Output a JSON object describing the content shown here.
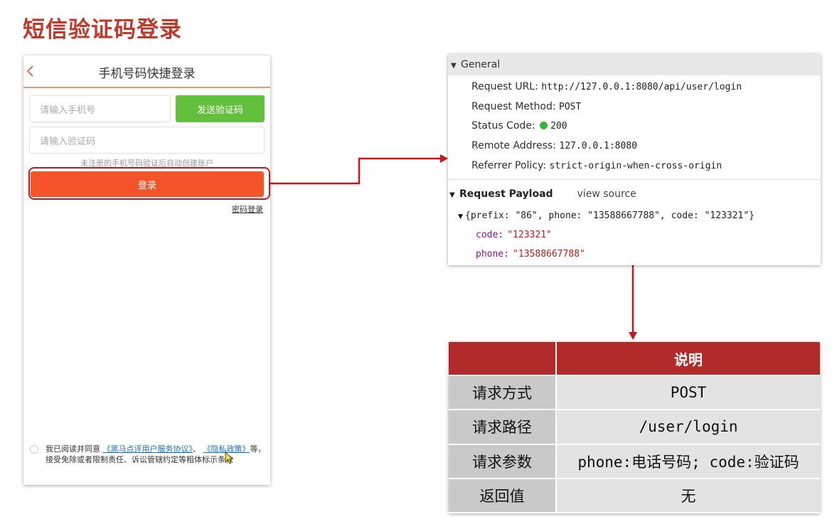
{
  "slide": {
    "title": "短信验证码登录"
  },
  "phone": {
    "title": "手机号码快捷登录",
    "phone_placeholder": "请输入手机号",
    "code_placeholder": "请输入验证码",
    "send_code_label": "发送验证码",
    "hint": "未注册的手机号码验证后自动创建账户",
    "login_label": "登录",
    "password_login_link": "密码登录",
    "agreement": {
      "prefix": "我已阅读并同意",
      "link1": "《黑马点评用户服务协议》",
      "sep": "、",
      "link2": "《隐私政策》",
      "suffix": "等，接受免除或者限制责任、诉讼管辖约定等粗体标示条款"
    },
    "accent_color": "#f5542a",
    "send_color": "#62c03c"
  },
  "devtools": {
    "general_label": "General",
    "rows": [
      {
        "key": "Request URL:",
        "value": "http://127.0.0.1:8080/api/user/login"
      },
      {
        "key": "Request Method:",
        "value": "POST"
      },
      {
        "key": "Status Code:",
        "value": "200"
      },
      {
        "key": "Remote Address:",
        "value": "127.0.0.1:8080"
      },
      {
        "key": "Referrer Policy:",
        "value": "strict-origin-when-cross-origin"
      }
    ],
    "payload_label": "Request Payload",
    "view_source": "view source",
    "payload_summary": "{prefix: \"86\", phone: \"13588667788\", code: \"123321\"}",
    "payload_fields": [
      {
        "key": "code:",
        "value": "\"123321\""
      },
      {
        "key": "phone:",
        "value": "\"13588667788\""
      }
    ],
    "status_color": "#3cb13c"
  },
  "info_table": {
    "header": {
      "left": "",
      "right": "说明"
    },
    "rows": [
      {
        "label": "请求方式",
        "value": "POST"
      },
      {
        "label": "请求路径",
        "value": "/user/login"
      },
      {
        "label": "请求参数",
        "value": "phone:电话号码; code:验证码"
      },
      {
        "label": "返回值",
        "value": "无"
      }
    ],
    "header_color": "#b22a2a",
    "connector_color": "#c4161c"
  }
}
